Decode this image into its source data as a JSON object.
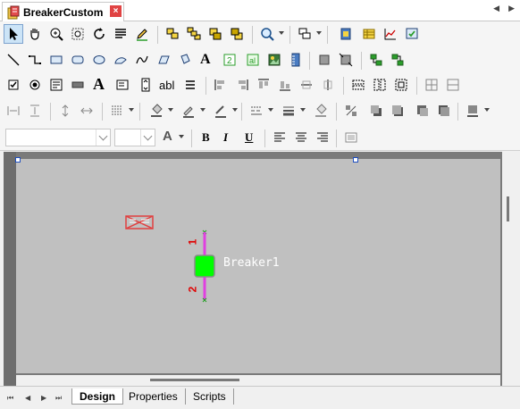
{
  "window": {
    "title": "BreakerCustom",
    "close_label": "×",
    "nav_prev": "◀",
    "nav_next": "▶"
  },
  "font_bar": {
    "bold": "B",
    "italic": "I",
    "underline": "U",
    "text_color_glyph": "A"
  },
  "toolbar_text": {
    "text_tool": "A",
    "label_tool": "A",
    "textbox_tool": "abl"
  },
  "canvas": {
    "component_label": "Breaker1",
    "pin1_label": "1",
    "pin2_label": "2",
    "breaker_color": "#00ff00",
    "wire_color": "#e040e0",
    "background": "#c0c0c0"
  },
  "bottom_tabs": [
    {
      "label": "Design",
      "active": true
    },
    {
      "label": "Properties",
      "active": false
    },
    {
      "label": "Scripts",
      "active": false
    }
  ],
  "bottom_nav": {
    "first": "⏮",
    "prev": "◀",
    "next": "▶",
    "last": "⏭"
  }
}
